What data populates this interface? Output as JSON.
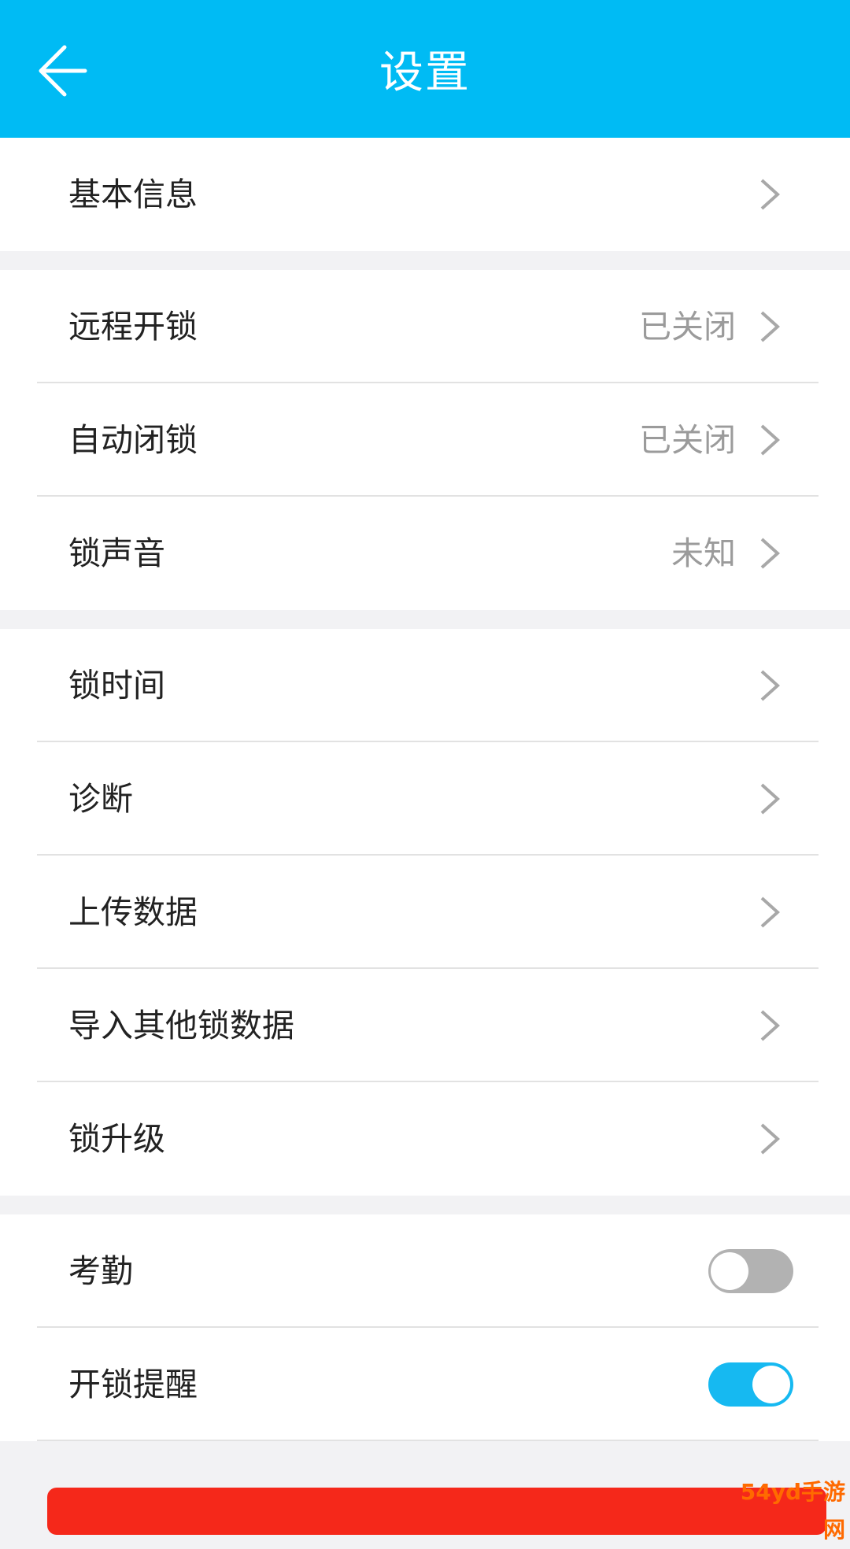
{
  "header": {
    "title": "设置"
  },
  "groups": [
    {
      "items": [
        {
          "label": "基本信息",
          "value": ""
        }
      ]
    },
    {
      "items": [
        {
          "label": "远程开锁",
          "value": "已关闭"
        },
        {
          "label": "自动闭锁",
          "value": "已关闭"
        },
        {
          "label": "锁声音",
          "value": "未知"
        }
      ]
    },
    {
      "items": [
        {
          "label": "锁时间",
          "value": ""
        },
        {
          "label": "诊断",
          "value": ""
        },
        {
          "label": "上传数据",
          "value": ""
        },
        {
          "label": "导入其他锁数据",
          "value": ""
        },
        {
          "label": "锁升级",
          "value": ""
        }
      ]
    },
    {
      "items": [
        {
          "label": "考勤",
          "toggle": "off"
        },
        {
          "label": "开锁提醒",
          "toggle": "on"
        }
      ]
    }
  ],
  "watermark": "54yd手游网",
  "colors": {
    "header": "#00bbf4",
    "toggle_on": "#16b9f1",
    "toggle_off": "#b2b2b2",
    "danger": "#f5281a"
  }
}
